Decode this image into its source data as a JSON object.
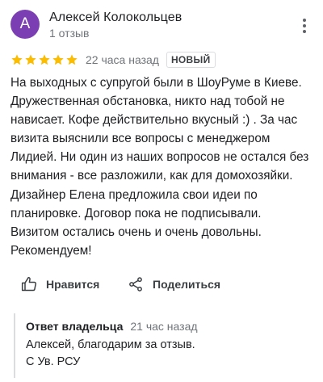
{
  "reviewer": {
    "avatar_letter": "A",
    "avatar_color": "#7b3fb3",
    "name": "Алексей Колокольцев",
    "meta": "1 отзыв"
  },
  "menu": {
    "icon": "more-vert-icon"
  },
  "rating": {
    "stars": 5,
    "max_stars": 5,
    "star_color": "#fbbc04",
    "time_ago": "22 часа назад",
    "badge": "НОВЫЙ"
  },
  "review": {
    "lines": [
      "На выходных с супругой были в ШоуРуме в Киеве.",
      "Дружественная обстановка, никто над тобой не",
      "нависает. Кофе действительно вкусный :) .  За час",
      "визита выяснили все вопросы с менеджером",
      "Лидией. Ни один из наших вопросов не остался без",
      "внимания - все разложили, как для домохозяйки.",
      "Дизайнер Елена предложила свои идеи по",
      "планировке. Договор пока не подписывали.",
      "Визитом остались очень и очень довольны.",
      "Рекомендуем!"
    ]
  },
  "actions": {
    "like": {
      "label": "Нравится",
      "icon": "thumb-up-icon"
    },
    "share": {
      "label": "Поделиться",
      "icon": "share-icon"
    }
  },
  "owner_response": {
    "label": "Ответ владельца",
    "time_ago": "21 час назад",
    "lines": [
      "Алексей, благодарим за отзыв.",
      "С Ув. РСУ"
    ]
  }
}
